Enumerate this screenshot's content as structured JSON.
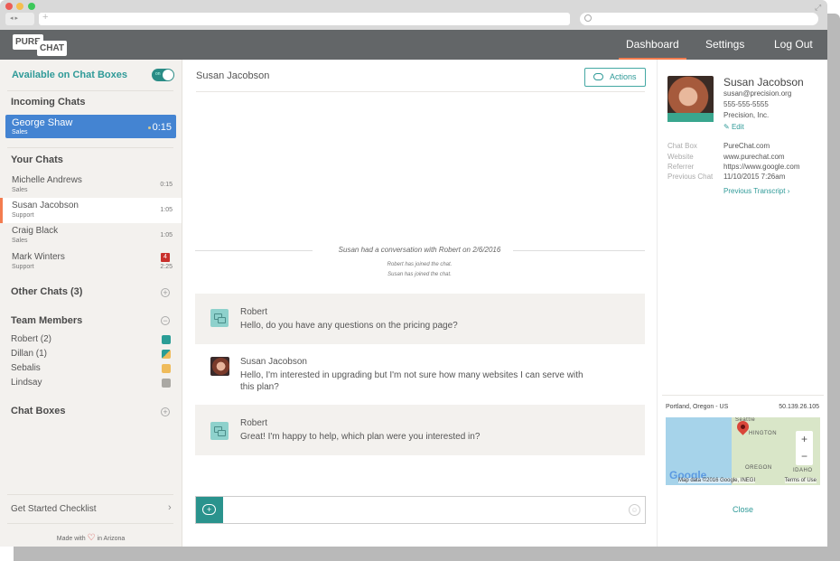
{
  "browser": {
    "url": "",
    "new_tab_glyph": "+",
    "search_placeholder": ""
  },
  "nav": {
    "logo_part1": "PURE",
    "logo_part2": "CHAT",
    "links": [
      {
        "label": "Dashboard",
        "active": true
      },
      {
        "label": "Settings",
        "active": false
      },
      {
        "label": "Log Out",
        "active": false
      }
    ],
    "accent": "#f37c4f"
  },
  "sidebar": {
    "availability_label": "Available on Chat Boxes",
    "availability_toggle": "on",
    "incoming_title": "Incoming Chats",
    "incoming": {
      "name": "George Shaw",
      "dept": "Sales",
      "time": "0:15"
    },
    "your_chats_title": "Your Chats",
    "your_chats": [
      {
        "name": "Michelle Andrews",
        "dept": "Sales",
        "time": "0:15",
        "badge": null
      },
      {
        "name": "Susan Jacobson",
        "dept": "Support",
        "time": "1:05",
        "badge": null,
        "active": true
      },
      {
        "name": "Craig Black",
        "dept": "Sales",
        "time": "1:05",
        "badge": null
      },
      {
        "name": "Mark Winters",
        "dept": "Support",
        "time": "2:25",
        "badge": "4"
      }
    ],
    "other_chats_title": "Other Chats (3)",
    "team_members_title": "Team Members",
    "team_members": [
      {
        "name": "Robert (2)",
        "color": "#2a9d96"
      },
      {
        "name": "Dillan (1)",
        "color": "#2a9d96/#efbb5a"
      },
      {
        "name": "Sebalis",
        "color": "#efbb5a"
      },
      {
        "name": "Lindsay",
        "color": "#aaa8a3"
      }
    ],
    "chat_boxes_title": "Chat Boxes",
    "checklist_label": "Get Started Checklist",
    "made_with_prefix": "Made with",
    "made_with_suffix": "in Arizona"
  },
  "main": {
    "title": "Susan Jacobson",
    "actions_label": "Actions",
    "conversation_note": "Susan had a conversation with Robert on 2/6/2016",
    "system_notes": [
      "Robert has joined the chat.",
      "Susan has joined the chat."
    ],
    "messages": [
      {
        "author": "Robert",
        "text": "Hello, do you have any questions on the pricing page?",
        "type": "operator"
      },
      {
        "author": "Susan Jacobson",
        "text": "Hello, I'm interested in upgrading but I'm not sure how many websites I can serve with this plan?",
        "type": "visitor"
      },
      {
        "author": "Robert",
        "text": "Great! I'm happy to help, which plan were you interested in?",
        "type": "operator"
      }
    ],
    "composer_placeholder": ""
  },
  "profile": {
    "name": "Susan Jacobson",
    "email": "susan@precision.org",
    "phone": "555-555-5555",
    "company": "Precision, Inc.",
    "edit_label": "Edit",
    "details": [
      {
        "key": "Chat Box",
        "value": "PureChat.com"
      },
      {
        "key": "Website",
        "value": "www.purechat.com"
      },
      {
        "key": "Referrer",
        "value": "https://www.google.com"
      },
      {
        "key": "Previous Chat",
        "value": "11/10/2015 7:26am"
      }
    ],
    "previous_transcript_label": "Previous Transcript",
    "location": "Portland, Oregon - US",
    "ip": "50.139.26.105",
    "map": {
      "labels": [
        "Seattle",
        "HINGTON",
        "OREGON",
        "IDAHO"
      ],
      "footer": "Map data ©2016 Google, INEGI",
      "terms": "Terms of Use",
      "brand": "Google",
      "zoom_in": "+",
      "zoom_out": "−"
    },
    "close_label": "Close"
  }
}
